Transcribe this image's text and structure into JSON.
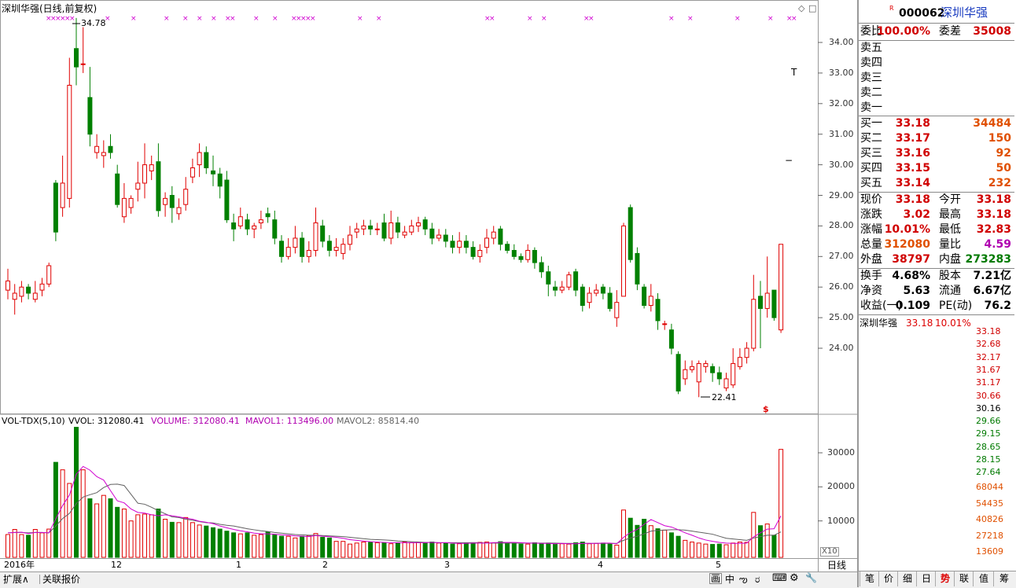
{
  "header": {
    "title": "深圳华强(日线,前复权)",
    "max_label": "34.78",
    "min_label": "22.41"
  },
  "price_axis": [
    "34.00",
    "33.00",
    "32.00",
    "31.00",
    "30.00",
    "29.00",
    "28.00",
    "27.00",
    "26.00",
    "25.00",
    "24.00"
  ],
  "volume_header": {
    "name": "VOL-TDX(5,10)",
    "vvol": "VVOL: 312080.41",
    "volume": "VOLUME: 312080.41",
    "mavol1": "MAVOL1: 113496.00",
    "mavol2": "MAVOL2: 85814.40"
  },
  "volume_axis": [
    "30000",
    "20000",
    "10000"
  ],
  "volume_multiplier": "X10",
  "date_axis": {
    "year": "2016年",
    "months": [
      "12",
      "1",
      "2",
      "3",
      "4",
      "5"
    ]
  },
  "period_label": "日线",
  "bottom_tabs": {
    "expand": "扩展∧",
    "related": "关联报价"
  },
  "toolbar_icons": [
    "画",
    "中",
    "ఌ",
    "ರ",
    "⌨",
    "⚙",
    "🔧"
  ],
  "quote": {
    "market_mark": "R",
    "code": "000062",
    "name": "深圳华强",
    "weibi_label": "委比",
    "weibi": "100.00%",
    "weicha_label": "委差",
    "weicha": "35008",
    "sell": [
      {
        "label": "卖五",
        "price": "",
        "vol": ""
      },
      {
        "label": "卖四",
        "price": "",
        "vol": ""
      },
      {
        "label": "卖三",
        "price": "",
        "vol": ""
      },
      {
        "label": "卖二",
        "price": "",
        "vol": ""
      },
      {
        "label": "卖一",
        "price": "",
        "vol": ""
      }
    ],
    "buy": [
      {
        "label": "买一",
        "price": "33.18",
        "vol": "34484"
      },
      {
        "label": "买二",
        "price": "33.17",
        "vol": "150"
      },
      {
        "label": "买三",
        "price": "33.16",
        "vol": "92"
      },
      {
        "label": "买四",
        "price": "33.15",
        "vol": "50"
      },
      {
        "label": "买五",
        "price": "33.14",
        "vol": "232"
      }
    ],
    "stats1": [
      {
        "l1": "现价",
        "v1": "33.18",
        "l2": "今开",
        "v2": "33.18"
      },
      {
        "l1": "涨跌",
        "v1": "3.02",
        "l2": "最高",
        "v2": "33.18"
      },
      {
        "l1": "涨幅",
        "v1": "10.01%",
        "l2": "最低",
        "v2": "32.83"
      },
      {
        "l1": "总量",
        "v1": "312080",
        "l2": "量比",
        "v2": "4.59"
      },
      {
        "l1": "外盘",
        "v1": "38797",
        "l2": "内盘",
        "v2": "273283"
      }
    ],
    "stats2": [
      {
        "l1": "换手",
        "v1": "4.68%",
        "l2": "股本",
        "v2": "7.21亿"
      },
      {
        "l1": "净资",
        "v1": "5.63",
        "l2": "流通",
        "v2": "6.67亿"
      },
      {
        "l1": "收益(一)",
        "v1": "0.109",
        "l2": "PE(动)",
        "v2": "76.2"
      }
    ]
  },
  "mini": {
    "name": "深圳华强",
    "price": "33.18",
    "pct": "10.01%",
    "price_axis": [
      "33.18",
      "32.68",
      "32.17",
      "31.67",
      "31.17",
      "30.66",
      "30.16",
      "29.66",
      "29.15",
      "28.65",
      "28.15",
      "27.64"
    ],
    "vol_axis": [
      "68044",
      "54435",
      "40826",
      "27218",
      "13609"
    ]
  },
  "right_tabs": [
    "笔",
    "价",
    "细",
    "日",
    "势",
    "联",
    "值",
    "筹"
  ],
  "colors": {
    "up": "#e00000",
    "down": "#008000",
    "ma1": "#d000d0",
    "ma2": "#606060",
    "bg": "#ffffff"
  },
  "chart_data": {
    "type": "candlestick",
    "title": "深圳华强(日线,前复权)",
    "ylim": [
      22,
      35
    ],
    "candles": [
      [
        25.9,
        26.2,
        26.6,
        25.6
      ],
      [
        25.6,
        25.8,
        26.1,
        25.1
      ],
      [
        25.7,
        26.0,
        26.2,
        25.5
      ],
      [
        26.0,
        25.8,
        26.1,
        25.6
      ],
      [
        25.6,
        25.8,
        26.2,
        25.5
      ],
      [
        25.9,
        26.1,
        26.3,
        25.7
      ],
      [
        26.1,
        26.7,
        26.8,
        26.0
      ],
      [
        29.4,
        27.8,
        29.5,
        27.5
      ],
      [
        28.6,
        29.4,
        30.3,
        28.3
      ],
      [
        28.9,
        32.6,
        33.5,
        28.6
      ],
      [
        33.8,
        33.2,
        34.8,
        32.6
      ],
      [
        33.3,
        33.3,
        34.5,
        33.0
      ],
      [
        32.2,
        31.0,
        33.2,
        30.6
      ],
      [
        30.4,
        30.6,
        31.0,
        30.2
      ],
      [
        30.3,
        30.4,
        30.8,
        29.9
      ],
      [
        30.6,
        30.4,
        31.0,
        30.2
      ],
      [
        29.7,
        28.7,
        30.0,
        28.6
      ],
      [
        28.3,
        28.9,
        29.4,
        28.1
      ],
      [
        28.6,
        28.9,
        29.0,
        28.4
      ],
      [
        29.2,
        29.4,
        30.1,
        28.8
      ],
      [
        29.4,
        30.0,
        30.7,
        28.9
      ],
      [
        29.8,
        30.0,
        30.3,
        29.5
      ],
      [
        30.1,
        28.5,
        30.7,
        28.3
      ],
      [
        28.7,
        28.9,
        29.1,
        28.3
      ],
      [
        29.0,
        28.6,
        29.3,
        28.1
      ],
      [
        28.4,
        28.6,
        28.9,
        28.2
      ],
      [
        28.7,
        29.2,
        29.6,
        28.5
      ],
      [
        29.6,
        29.9,
        30.2,
        29.4
      ],
      [
        30.0,
        30.4,
        30.7,
        29.6
      ],
      [
        30.4,
        29.9,
        30.6,
        29.7
      ],
      [
        29.8,
        29.7,
        30.3,
        29.3
      ],
      [
        29.7,
        29.3,
        29.9,
        28.9
      ],
      [
        29.5,
        28.2,
        29.8,
        28.1
      ],
      [
        28.1,
        27.9,
        28.4,
        27.5
      ],
      [
        28.0,
        28.3,
        28.6,
        27.9
      ],
      [
        28.2,
        27.9,
        28.4,
        27.7
      ],
      [
        27.9,
        28.0,
        28.1,
        27.6
      ],
      [
        28.1,
        28.2,
        28.5,
        27.9
      ],
      [
        28.4,
        28.3,
        28.6,
        28.1
      ],
      [
        28.2,
        27.6,
        28.5,
        27.4
      ],
      [
        27.5,
        27.0,
        27.7,
        26.8
      ],
      [
        27.0,
        27.3,
        27.6,
        26.9
      ],
      [
        27.3,
        27.6,
        28.0,
        27.1
      ],
      [
        27.6,
        27.0,
        27.8,
        26.8
      ],
      [
        27.0,
        27.2,
        27.5,
        26.8
      ],
      [
        27.2,
        28.1,
        28.6,
        27.0
      ],
      [
        28.0,
        27.5,
        28.2,
        27.3
      ],
      [
        27.5,
        27.2,
        27.7,
        27.0
      ],
      [
        27.2,
        27.3,
        27.6,
        27.0
      ],
      [
        27.1,
        27.4,
        27.6,
        26.9
      ],
      [
        27.4,
        27.7,
        28.0,
        27.2
      ],
      [
        27.8,
        27.9,
        28.1,
        27.6
      ],
      [
        27.9,
        28.0,
        28.2,
        27.7
      ],
      [
        28.0,
        27.9,
        28.2,
        27.7
      ],
      [
        27.9,
        27.9,
        28.1,
        27.7
      ],
      [
        28.1,
        27.6,
        28.4,
        27.5
      ],
      [
        27.6,
        28.1,
        28.5,
        27.4
      ],
      [
        28.1,
        27.8,
        28.3,
        27.6
      ],
      [
        27.7,
        27.8,
        28.0,
        27.6
      ],
      [
        27.8,
        28.0,
        28.2,
        27.7
      ],
      [
        28.0,
        28.1,
        28.3,
        27.8
      ],
      [
        28.2,
        27.9,
        28.3,
        27.7
      ],
      [
        27.9,
        27.6,
        28.1,
        27.4
      ],
      [
        27.6,
        27.7,
        27.9,
        27.5
      ],
      [
        27.7,
        27.5,
        27.9,
        27.3
      ],
      [
        27.5,
        27.3,
        27.7,
        27.1
      ],
      [
        27.3,
        27.5,
        27.8,
        27.1
      ],
      [
        27.5,
        27.3,
        27.7,
        27.1
      ],
      [
        27.3,
        27.0,
        27.5,
        26.9
      ],
      [
        27.0,
        27.2,
        27.4,
        26.8
      ],
      [
        27.3,
        27.6,
        27.9,
        27.1
      ],
      [
        27.6,
        27.8,
        28.0,
        27.4
      ],
      [
        27.9,
        27.4,
        28.0,
        27.2
      ],
      [
        27.4,
        27.2,
        27.5,
        27.1
      ],
      [
        27.2,
        27.0,
        27.4,
        26.9
      ],
      [
        27.0,
        26.9,
        27.1,
        26.8
      ],
      [
        26.9,
        27.2,
        27.4,
        26.8
      ],
      [
        27.2,
        26.8,
        27.3,
        26.6
      ],
      [
        26.8,
        26.5,
        27.0,
        26.3
      ],
      [
        26.5,
        26.1,
        26.7,
        25.7
      ],
      [
        26.0,
        25.9,
        26.2,
        25.7
      ],
      [
        25.9,
        26.0,
        26.2,
        25.8
      ],
      [
        26.0,
        26.4,
        26.5,
        25.9
      ],
      [
        26.5,
        25.9,
        26.6,
        25.7
      ],
      [
        26.0,
        25.4,
        26.1,
        25.2
      ],
      [
        25.5,
        25.8,
        26.0,
        25.3
      ],
      [
        25.8,
        25.9,
        26.1,
        25.7
      ],
      [
        26.0,
        25.8,
        26.1,
        25.6
      ],
      [
        25.8,
        25.3,
        26.0,
        25.2
      ],
      [
        25.0,
        25.5,
        25.9,
        24.7
      ],
      [
        25.7,
        28.0,
        28.1,
        25.7
      ],
      [
        28.6,
        26.9,
        28.7,
        26.8
      ],
      [
        27.1,
        26.1,
        27.3,
        25.9
      ],
      [
        26.0,
        25.4,
        26.1,
        25.3
      ],
      [
        25.4,
        25.7,
        26.1,
        25.2
      ],
      [
        25.6,
        24.9,
        25.8,
        24.6
      ],
      [
        24.8,
        24.8,
        24.9,
        24.6
      ],
      [
        24.6,
        24.0,
        24.8,
        23.8
      ],
      [
        23.8,
        22.6,
        23.9,
        22.5
      ],
      [
        23.0,
        23.3,
        23.6,
        22.8
      ],
      [
        23.3,
        23.4,
        23.6,
        23.2
      ],
      [
        22.9,
        23.5,
        23.6,
        22.4
      ],
      [
        23.4,
        23.5,
        23.6,
        23.2
      ],
      [
        23.4,
        23.2,
        23.5,
        22.9
      ],
      [
        23.2,
        23.0,
        23.4,
        22.8
      ],
      [
        22.7,
        23.0,
        23.2,
        22.6
      ],
      [
        22.8,
        23.5,
        24.0,
        22.7
      ],
      [
        23.4,
        23.7,
        24.0,
        23.3
      ],
      [
        23.7,
        24.0,
        24.2,
        23.5
      ],
      [
        24.0,
        25.6,
        26.4,
        23.9
      ],
      [
        25.7,
        25.3,
        26.2,
        24.0
      ],
      [
        25.3,
        25.8,
        27.0,
        25.0
      ],
      [
        25.9,
        25.0,
        25.5,
        24.9
      ],
      [
        24.6,
        27.4,
        27.4,
        24.5
      ]
    ],
    "volumes": [
      6000,
      7500,
      6000,
      5800,
      7500,
      6500,
      7600,
      27200,
      25000,
      21000,
      37500,
      25000,
      16500,
      15000,
      17500,
      16500,
      14000,
      13500,
      10000,
      11800,
      12000,
      11800,
      13500,
      10500,
      9600,
      9500,
      11000,
      9500,
      8800,
      8500,
      8000,
      7600,
      7000,
      6500,
      6200,
      6500,
      5800,
      6000,
      6800,
      6000,
      5500,
      5500,
      5000,
      5500,
      5700,
      6300,
      5200,
      5000,
      4000,
      4000,
      3200,
      3500,
      3800,
      3700,
      3600,
      3600,
      3300,
      3500,
      3800,
      3600,
      3700,
      3600,
      3800,
      3500,
      3500,
      3200,
      3300,
      3500,
      3600,
      3700,
      3800,
      3600,
      3900,
      3500,
      3600,
      3200,
      3200,
      3600,
      3400,
      3500,
      3100,
      3300,
      3200,
      3600,
      3800,
      3300,
      3400,
      3500,
      3200,
      2900,
      13200,
      10800,
      8700,
      10500,
      8600,
      7700,
      7300,
      6500,
      5500,
      4300,
      3800,
      3500,
      3200,
      3100,
      3200,
      3000,
      3500,
      3800,
      3700,
      12500,
      8600,
      9100,
      5800,
      31000
    ],
    "mavol1": [
      6500,
      6600,
      6700,
      6300,
      6600,
      6600,
      6500,
      10600,
      14500,
      17600,
      23700,
      26000,
      24900,
      23000,
      22000,
      18900,
      15900,
      15300,
      13500,
      12500,
      12300,
      11800,
      11500,
      11800,
      11500,
      11200,
      10800,
      10500,
      9900,
      9600,
      9200,
      8500,
      8000,
      7500,
      7100,
      6800,
      6400,
      6200,
      6200,
      6100,
      5900,
      5800,
      5600,
      5500,
      5400,
      5700,
      5500,
      5400,
      5200,
      4900,
      4500,
      4300,
      4100,
      3900,
      3800,
      3700,
      3600,
      3600,
      3600,
      3600,
      3600,
      3600,
      3700,
      3600,
      3600,
      3500,
      3400,
      3400,
      3500,
      3500,
      3500,
      3600,
      3700,
      3700,
      3700,
      3600,
      3500,
      3500,
      3400,
      3400,
      3300,
      3400,
      3300,
      3300,
      3400,
      3400,
      3400,
      3500,
      3500,
      3300,
      5200,
      6600,
      7500,
      9000,
      10400,
      9500,
      8600,
      8200,
      7400,
      6500,
      5800,
      5000,
      4400,
      4000,
      3700,
      3500,
      3400,
      3400,
      3500,
      5300,
      6500,
      7600,
      7700,
      11500
    ],
    "mavol2": [
      6500,
      6600,
      6600,
      6500,
      6600,
      6600,
      6500,
      8500,
      10700,
      12200,
      15100,
      17000,
      17700,
      18300,
      19800,
      20700,
      20800,
      20400,
      17800,
      15200,
      14900,
      14000,
      13000,
      12100,
      11200,
      11000,
      10500,
      10200,
      9800,
      9500,
      9400,
      9000,
      8700,
      8500,
      8100,
      7700,
      7400,
      7100,
      6900,
      6600,
      6400,
      6200,
      6000,
      5900,
      5800,
      5800,
      5700,
      5600,
      5500,
      5400,
      5200,
      5000,
      4800,
      4600,
      4500,
      4400,
      4300,
      4100,
      4000,
      3900,
      3800,
      3700,
      3700,
      3600,
      3600,
      3600,
      3600,
      3600,
      3600,
      3600,
      3500,
      3500,
      3500,
      3500,
      3500,
      3500,
      3500,
      3500,
      3500,
      3500,
      3500,
      3400,
      3400,
      3400,
      3400,
      3400,
      3400,
      3400,
      3400,
      3400,
      4300,
      5000,
      5500,
      6200,
      7000,
      7200,
      7300,
      7400,
      7400,
      7300,
      7000,
      6700,
      6400,
      6100,
      5500,
      4900,
      4700,
      4500,
      4300,
      5000,
      5400,
      5800,
      5800,
      6800
    ],
    "ylim_volume": [
      0,
      37500
    ],
    "mini_intraday": {
      "open": 33.18,
      "prev_close": 30.16,
      "ylim": [
        27.64,
        33.18
      ]
    }
  }
}
